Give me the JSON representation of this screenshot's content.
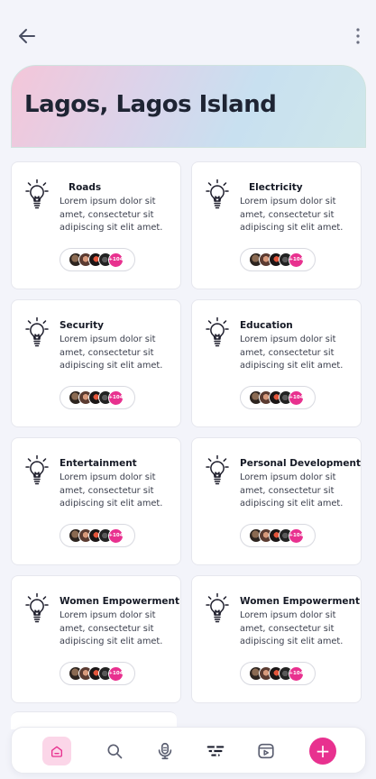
{
  "header": {
    "back_icon": "arrow-left-icon",
    "more_icon": "more-vertical-icon",
    "title": "Lagos, Lagos Island"
  },
  "colors": {
    "accent": "#e8318f",
    "background": "#f3f4fa",
    "card": "#ffffff"
  },
  "cards": [
    {
      "title": "Roads",
      "description": "Lorem ipsum dolor sit amet, consectetur sit adipiscing sit elit amet.",
      "more_count": "+104"
    },
    {
      "title": "Electricity",
      "description": "Lorem ipsum dolor sit amet, consectetur sit adipiscing sit elit amet.",
      "more_count": "+104"
    },
    {
      "title": "Security",
      "description": "Lorem ipsum dolor sit amet, consectetur sit adipiscing sit elit amet.",
      "more_count": "+104"
    },
    {
      "title": "Education",
      "description": "Lorem ipsum dolor sit amet, consectetur sit adipiscing sit elit amet.",
      "more_count": "+104"
    },
    {
      "title": "Entertainment",
      "description": "Lorem ipsum dolor sit amet, consectetur sit adipiscing sit elit amet.",
      "more_count": "+104"
    },
    {
      "title": "Personal Development",
      "description": "Lorem ipsum dolor sit amet, consectetur sit adipiscing sit elit amet.",
      "more_count": "+104"
    },
    {
      "title": "Women Empowerment",
      "description": "Lorem ipsum dolor sit amet, consectetur sit adipiscing sit elit amet.",
      "more_count": "+104"
    },
    {
      "title": "Women Empowerment",
      "description": "Lorem ipsum dolor sit amet, consectetur sit adipiscing sit elit amet.",
      "more_count": "+104"
    }
  ],
  "bottom_nav": {
    "items": [
      "home-icon",
      "search-icon",
      "microphone-icon",
      "filter-icon",
      "video-icon"
    ],
    "fab_icon": "plus-icon",
    "fab_label": "+"
  }
}
